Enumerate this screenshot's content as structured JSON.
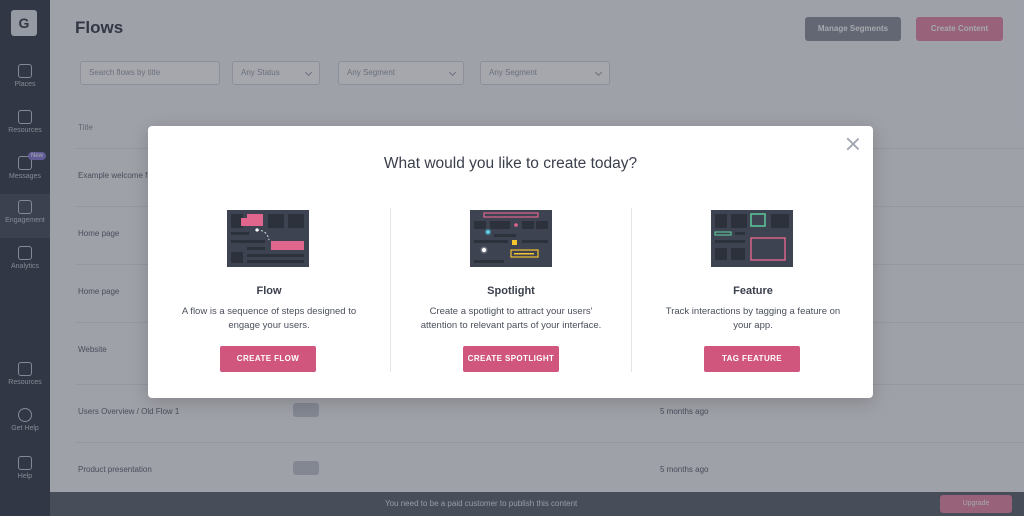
{
  "sidebar": {
    "logo": "G",
    "items": [
      {
        "label": "Places"
      },
      {
        "label": "Resources"
      },
      {
        "label": "Messages",
        "badge": "New"
      },
      {
        "label": "Engagement"
      },
      {
        "label": "Analytics"
      },
      {
        "label": "Resources"
      },
      {
        "label": "Get Help"
      },
      {
        "label": "Help"
      }
    ]
  },
  "header": {
    "title": "Flows",
    "manage_button": "Manage Segments",
    "create_button": "Create Content"
  },
  "filters": {
    "search_placeholder": "Search flows by title",
    "status": "Any Status",
    "segment": "Any Segment",
    "tag": "Any Segment"
  },
  "table": {
    "column_title": "Title",
    "rows": [
      {
        "title": "Example welcome flow",
        "date": ""
      },
      {
        "title": "Home page",
        "date": ""
      },
      {
        "title": "Home page",
        "date": ""
      },
      {
        "title": "Website",
        "date": ""
      },
      {
        "title": "Users Overview / Old Flow 1",
        "date": "5 months ago"
      },
      {
        "title": "Product presentation",
        "date": "5 months ago"
      }
    ]
  },
  "bottom_bar": {
    "text": "You need to be a paid customer to publish this content",
    "button": "Upgrade"
  },
  "modal": {
    "title": "What would you like to create today?",
    "options": [
      {
        "name": "Flow",
        "description": "A flow is a sequence of steps designed to engage your users.",
        "button": "CREATE FLOW",
        "icon": "flow-illustration"
      },
      {
        "name": "Spotlight",
        "description": "Create a spotlight to attract your users' attention to relevant parts of your interface.",
        "button": "CREATE SPOTLIGHT",
        "icon": "spotlight-illustration"
      },
      {
        "name": "Feature",
        "description": "Track interactions by tagging a feature on your app.",
        "button": "TAG FEATURE",
        "icon": "feature-illustration"
      }
    ]
  },
  "colors": {
    "accent": "#d1567e",
    "illustration_bg": "#3d4350",
    "highlight_pink": "#e0668e",
    "highlight_green": "#5fd3a0",
    "highlight_yellow": "#f4c431",
    "highlight_cyan": "#5fd8f0"
  }
}
